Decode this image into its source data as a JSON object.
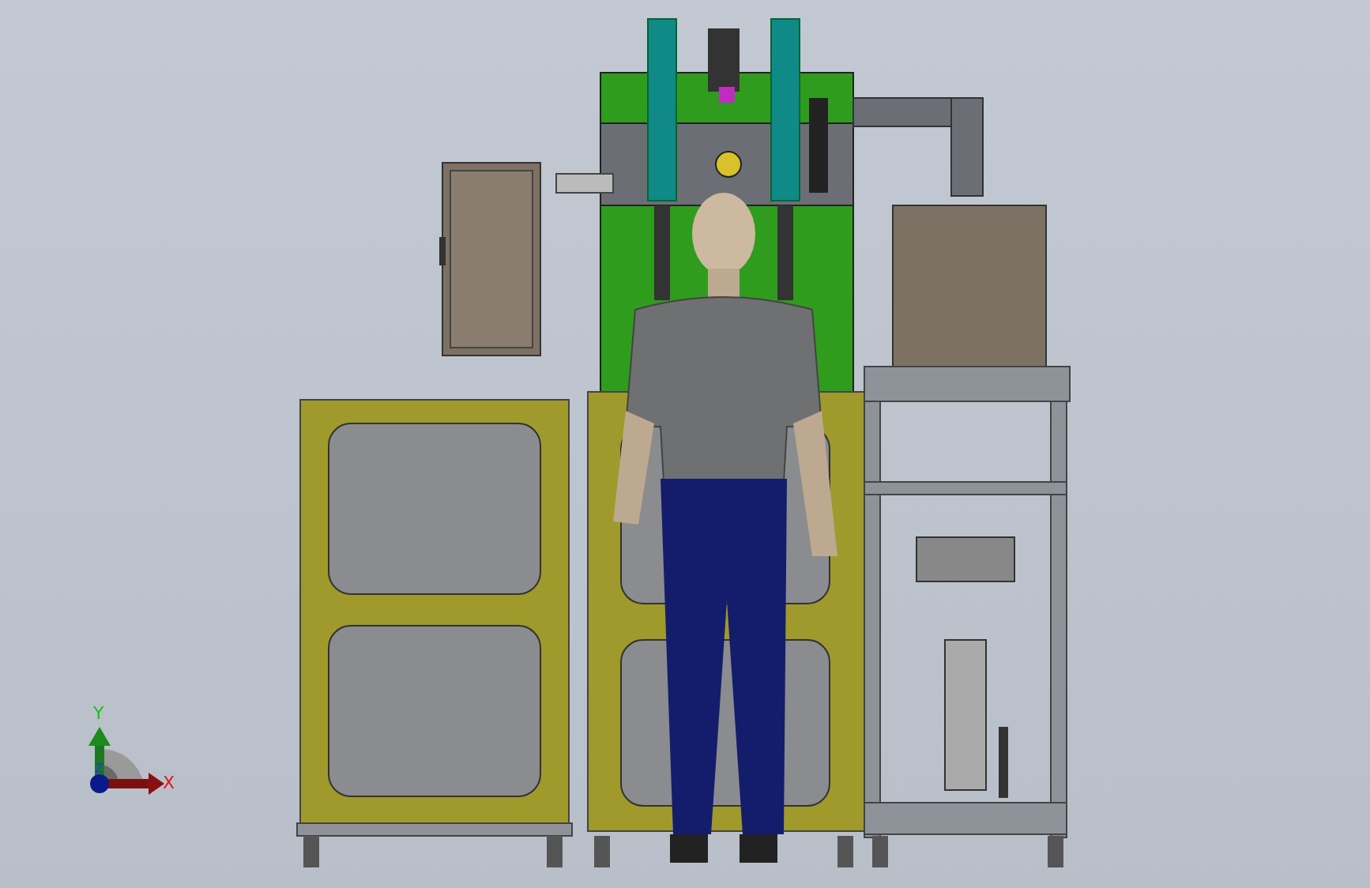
{
  "viewport": {
    "triad": {
      "x_label": "X",
      "y_label": "Y",
      "z_label": "Z"
    }
  }
}
